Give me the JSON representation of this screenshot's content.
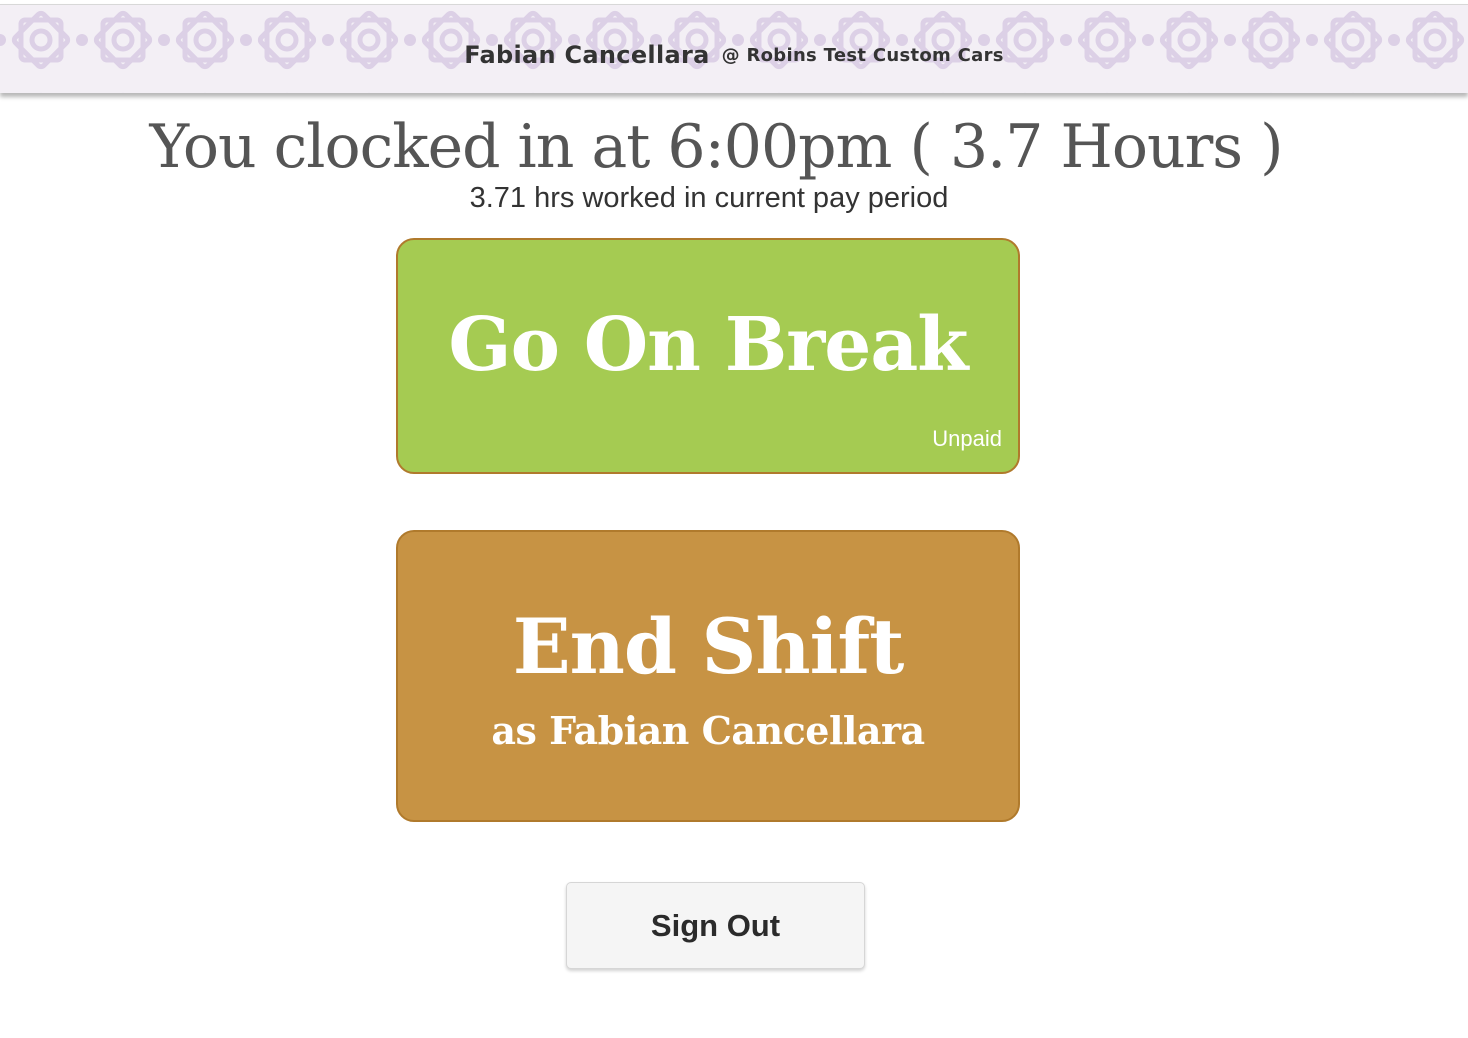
{
  "header": {
    "user_name": "Fabian Cancellara",
    "org": "@ Robins Test Custom Cars",
    "pattern_icon": "star-ornament-pattern",
    "pattern_color": "#dcd0e6",
    "background_color": "#f3eff5"
  },
  "status": {
    "clocked_in_text": "You clocked in at 6:00pm ( 3.7 Hours )",
    "hours_worked_text": "3.71 hrs worked in current pay period"
  },
  "actions": {
    "break_label": "Go On Break",
    "break_note": "Unpaid",
    "break_color": "#a5cb52",
    "end_shift_label": "End Shift",
    "end_shift_sub": "as Fabian Cancellara",
    "end_shift_color": "#c79344",
    "sign_out_label": "Sign Out"
  }
}
